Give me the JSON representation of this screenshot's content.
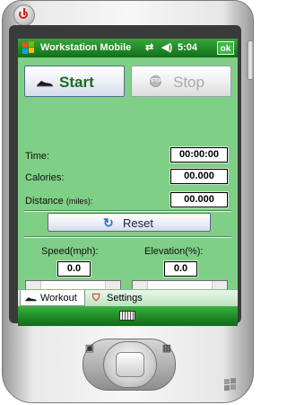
{
  "titlebar": {
    "title": "Workstation Mobile",
    "time": "5:04",
    "ok_label": "ok",
    "icons": [
      "windows-start-icon",
      "signal-icon",
      "volume-icon"
    ]
  },
  "controls": {
    "start_label": "Start",
    "stop_label": "Stop",
    "stop_icon_text": "STOP",
    "reset_label": "Reset"
  },
  "stats": {
    "time_label": "Time:",
    "time_value": "00:00:00",
    "calories_label": "Calories:",
    "calories_value": "00.000",
    "distance_label": "Distance",
    "distance_unit": "(miles):",
    "distance_value": "00.000"
  },
  "speed": {
    "label": "Speed(mph):",
    "value": "0.0"
  },
  "elevation": {
    "label": "Elevation(%):",
    "value": "0.0"
  },
  "tabs": [
    {
      "label": "Workout",
      "active": true
    },
    {
      "label": "Settings",
      "active": false
    }
  ],
  "colors": {
    "panel": "#7fcf86",
    "titlebar": "#1f8a26",
    "start_text": "#1c6b24",
    "stop_text": "#a9a9a9"
  }
}
